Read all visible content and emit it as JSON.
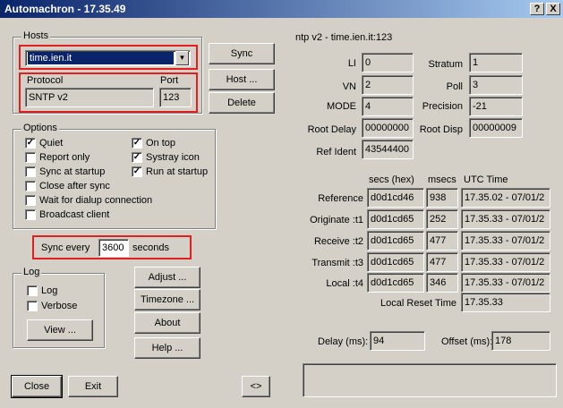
{
  "window": {
    "title": "Automachron - 17.35.49",
    "help_btn": "?",
    "close_btn": "X"
  },
  "hosts": {
    "group_label": "Hosts",
    "selected_host": "time.ien.it",
    "protocol_label": "Protocol",
    "port_label": "Port",
    "protocol_value": "SNTP v2",
    "port_value": "123",
    "sync_btn": "Sync",
    "host_btn": "Host ...",
    "delete_btn": "Delete"
  },
  "options": {
    "group_label": "Options",
    "items": [
      {
        "label": "Quiet",
        "checked": true
      },
      {
        "label": "Report only",
        "checked": false
      },
      {
        "label": "Sync at startup",
        "checked": false
      },
      {
        "label": "Close after sync",
        "checked": false
      },
      {
        "label": "Wait for dialup connection",
        "checked": false
      },
      {
        "label": "Broadcast client",
        "checked": false
      },
      {
        "label": "On top",
        "checked": true
      },
      {
        "label": "Systray icon",
        "checked": true
      },
      {
        "label": "Run at startup",
        "checked": true
      }
    ]
  },
  "sync_every": {
    "label": "Sync every",
    "value": "3600",
    "unit": "seconds"
  },
  "log": {
    "group_label": "Log",
    "log_label": "Log",
    "log_checked": false,
    "verbose_label": "Verbose",
    "verbose_checked": false,
    "view_btn": "View ..."
  },
  "buttons": {
    "adjust": "Adjust ...",
    "timezone": "Timezone ...",
    "about": "About",
    "help": "Help ...",
    "close": "Close",
    "exit": "Exit",
    "toggle": "<>"
  },
  "ntp": {
    "header": "ntp v2 - time.ien.it:123",
    "li_label": "LI",
    "li": "0",
    "vn_label": "VN",
    "vn": "2",
    "mode_label": "MODE",
    "mode": "4",
    "root_delay_label": "Root Delay",
    "root_delay": "00000000",
    "ref_ident_label": "Ref Ident",
    "ref_ident": "43544400",
    "stratum_label": "Stratum",
    "stratum": "1",
    "poll_label": "Poll",
    "poll": "3",
    "precision_label": "Precision",
    "precision": "-21",
    "root_disp_label": "Root Disp",
    "root_disp": "00000009",
    "col_secs": "secs (hex)",
    "col_msecs": "msecs",
    "col_utc": "UTC Time",
    "rows": [
      {
        "label": "Reference",
        "secs": "d0d1cd46",
        "msecs": "938",
        "utc": "17.35.02 - 07/01/2"
      },
      {
        "label": "Originate :t1",
        "secs": "d0d1cd65",
        "msecs": "252",
        "utc": "17.35.33 - 07/01/2"
      },
      {
        "label": "Receive :t2",
        "secs": "d0d1cd65",
        "msecs": "477",
        "utc": "17.35.33 - 07/01/2"
      },
      {
        "label": "Transmit :t3",
        "secs": "d0d1cd65",
        "msecs": "477",
        "utc": "17.35.33 - 07/01/2"
      },
      {
        "label": "Local :t4",
        "secs": "d0d1cd65",
        "msecs": "346",
        "utc": "17.35.33 - 07/01/2"
      }
    ],
    "local_reset_label": "Local Reset Time",
    "local_reset": "17.35.33",
    "delay_label": "Delay (ms):",
    "delay": "94",
    "offset_label": "Offset (ms):",
    "offset": "178",
    "status_text": ""
  }
}
